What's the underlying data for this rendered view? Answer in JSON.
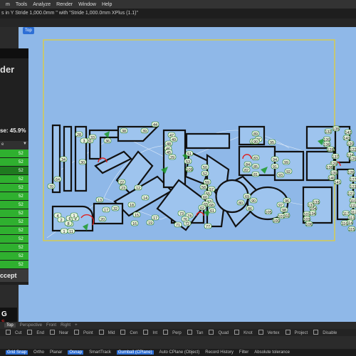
{
  "menu": [
    "m",
    "Tools",
    "Analyze",
    "Render",
    "Window",
    "Help"
  ],
  "command_line": "s in Y Stride 1,000.0mm \" with \"Stride 1,000.0mm XPlus (1.1)\"",
  "viewport": {
    "label": "Top",
    "labels": [
      "44",
      "39",
      "38",
      "31",
      "28",
      "3",
      "33",
      "36",
      "34",
      "30",
      "70",
      "64",
      "22",
      "23",
      "12",
      "14",
      "18",
      "15",
      "16",
      "19",
      "17",
      "17",
      "13",
      "20",
      "32",
      "4",
      "2",
      "1",
      "11",
      "5",
      "8",
      "6",
      "9",
      "1",
      "47",
      "49",
      "48",
      "46",
      "45",
      "29",
      "51",
      "53",
      "50",
      "52",
      "59",
      "58",
      "57",
      "55",
      "60",
      "63",
      "65",
      "62",
      "61",
      "72",
      "71",
      "73",
      "74",
      "76",
      "77",
      "84",
      "85",
      "83",
      "82",
      "81",
      "68",
      "69",
      "80",
      "86",
      "90",
      "89",
      "88",
      "87",
      "90",
      "95",
      "94",
      "91",
      "93",
      "92",
      "99",
      "96",
      "97",
      "98",
      "102",
      "101",
      "100",
      "105",
      "106",
      "103",
      "107",
      "104",
      "131",
      "133",
      "134",
      "132",
      "135",
      "130",
      "136",
      "128",
      "137",
      "129",
      "138",
      "139",
      "140",
      "141",
      "142",
      "143",
      "120",
      "122",
      "124",
      "125",
      "126",
      "127",
      "123",
      "121",
      "110",
      "111",
      "112",
      "113",
      "114",
      "115",
      "116",
      "117",
      "118",
      "119",
      "108",
      "109"
    ]
  },
  "left_panel": {
    "title": "der",
    "progress": "se: 45.9%",
    "filter_label": "e",
    "rows": [
      "52",
      "52",
      "52",
      "52",
      "52",
      "52",
      "52",
      "52",
      "52",
      "52",
      "52",
      "52",
      "52",
      "52"
    ],
    "accept": "ccept"
  },
  "bottom_tabs": [
    "Top",
    "Perspective",
    "Front",
    "Right",
    "+"
  ],
  "osnap": [
    "Cut",
    "End",
    "Near",
    "Point",
    "Mid",
    "Cen",
    "Int",
    "Perp",
    "Tan",
    "Quad",
    "Knot",
    "Vertex",
    "Project",
    "Disable"
  ],
  "status": [
    "Grid Snap",
    "Ortho",
    "Planar",
    "Osnap",
    "SmartTrack",
    "Gumball (CPlane)",
    "Auto CPlane (Object)",
    "Record History",
    "Filter",
    "Absolute tolerance"
  ],
  "status_active": [
    "Grid Snap",
    "Osnap",
    "Gumball (CPlane)"
  ],
  "colors": {
    "accent": "#2d6fd6",
    "viewport_bg": "#8fb8e8",
    "selection": "#e8d02a",
    "nest_green": "#2fb02f",
    "panel": "#202020"
  }
}
